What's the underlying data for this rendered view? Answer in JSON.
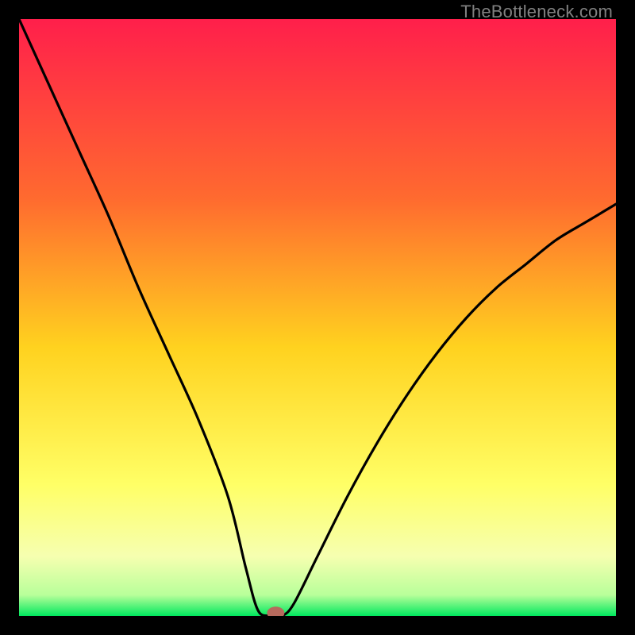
{
  "watermark": {
    "text": "TheBottleneck.com"
  },
  "chart_data": {
    "type": "line",
    "title": "",
    "xlabel": "",
    "ylabel": "",
    "xlim": [
      0,
      100
    ],
    "ylim": [
      0,
      100
    ],
    "series": [
      {
        "name": "bottleneck-curve",
        "x": [
          0,
          5,
          10,
          15,
          20,
          25,
          30,
          35,
          38,
          40,
          42,
          44,
          46,
          50,
          55,
          60,
          65,
          70,
          75,
          80,
          85,
          90,
          95,
          100
        ],
        "values": [
          100,
          89,
          78,
          67,
          55,
          44,
          33,
          20,
          8,
          1,
          0,
          0,
          2,
          10,
          20,
          29,
          37,
          44,
          50,
          55,
          59,
          63,
          66,
          69
        ]
      }
    ],
    "marker": {
      "x": 43,
      "y": 0.5,
      "color": "#b66a5d"
    },
    "gradient_stops": [
      {
        "offset": 0.0,
        "color": "#ff1f4b"
      },
      {
        "offset": 0.3,
        "color": "#ff6a2f"
      },
      {
        "offset": 0.55,
        "color": "#ffd21f"
      },
      {
        "offset": 0.78,
        "color": "#ffff66"
      },
      {
        "offset": 0.9,
        "color": "#f6ffb0"
      },
      {
        "offset": 0.965,
        "color": "#b8ff9a"
      },
      {
        "offset": 1.0,
        "color": "#00e85e"
      }
    ]
  }
}
